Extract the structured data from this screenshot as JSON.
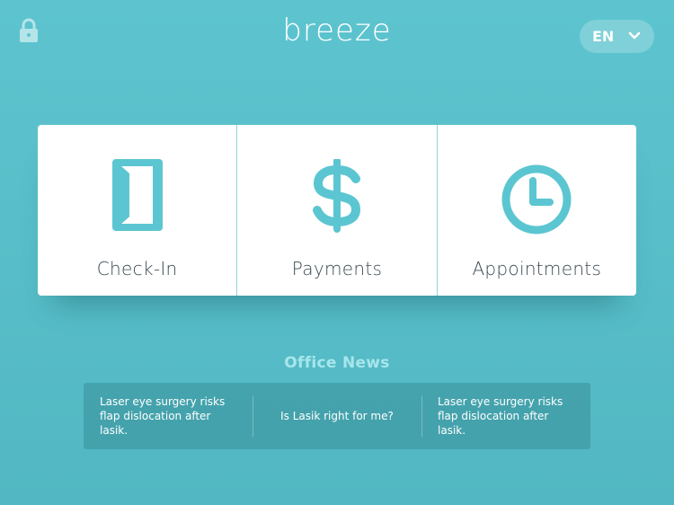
{
  "app": {
    "brand": "breeze"
  },
  "header": {
    "lock_icon": "lock-icon",
    "language": {
      "selected": "EN",
      "icon": "chevron-down-icon"
    }
  },
  "tiles": [
    {
      "label": "Check-In",
      "icon": "door-icon"
    },
    {
      "label": "Payments",
      "icon": "dollar-icon"
    },
    {
      "label": "Appointments",
      "icon": "clock-icon"
    }
  ],
  "news": {
    "title": "Office News",
    "items": [
      "Laser eye surgery risks flap dislocation after lasik.",
      "Is Lasik right for me?",
      "Laser eye surgery risks flap dislocation after lasik."
    ]
  },
  "colors": {
    "accent": "#5bc6d1",
    "background": "#5dc4cf",
    "tile_text": "#3a4a52",
    "news_title": "#a7e6ec"
  }
}
